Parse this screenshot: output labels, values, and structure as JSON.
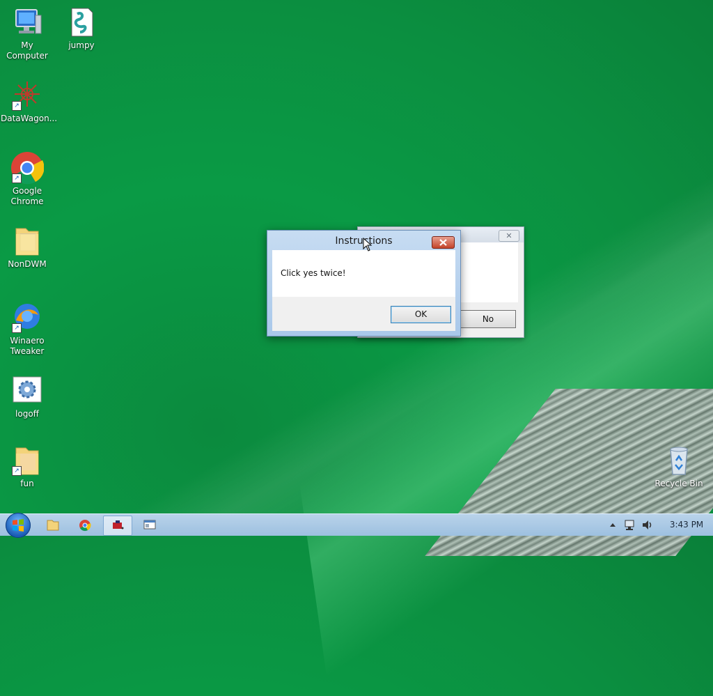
{
  "desktop": {
    "icons": [
      {
        "label": "My Computer",
        "icon": "computer-icon"
      },
      {
        "label": "jumpy",
        "icon": "script-file-icon"
      },
      {
        "label": "DataWagon...",
        "icon": "datawagon-icon"
      },
      {
        "label": "Google Chrome",
        "icon": "chrome-icon"
      },
      {
        "label": "NonDWM",
        "icon": "folder-icon"
      },
      {
        "label": "Winaero Tweaker",
        "icon": "winaero-icon"
      },
      {
        "label": "logoff",
        "icon": "settings-icon"
      },
      {
        "label": "fun",
        "icon": "folder-icon"
      },
      {
        "label": "Recycle Bin",
        "icon": "recycle-bin-icon"
      }
    ]
  },
  "dialog_back": {
    "no_label": "No"
  },
  "dialog": {
    "title": "Instructions",
    "message": "Click yes twice!",
    "ok_label": "OK"
  },
  "taskbar": {
    "clock": "3:43 PM"
  },
  "colors": {
    "desktop_green": "#0a9a45",
    "close_red": "#c4442a",
    "taskbar": "#b9d3ea"
  }
}
